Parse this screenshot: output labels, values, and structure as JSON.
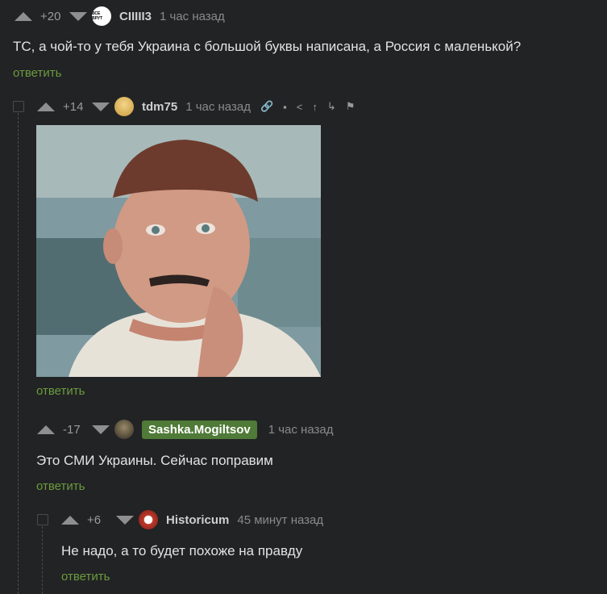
{
  "comments": [
    {
      "rating": "+20",
      "nick": "CIIIII3",
      "time": "1 час назад",
      "text": "ТС, а чой-то у тебя Украина с большой буквы написана, а Россия с маленькой?",
      "reply": "ответить",
      "avatar_text": "ВСЕ ВРУТ"
    },
    {
      "rating": "+14",
      "nick": "tdm75",
      "time": "1 час назад",
      "reply": "ответить"
    },
    {
      "rating": "-17",
      "nick": "Sashka.Mogiltsov",
      "time": "1 час назад",
      "text": "Это СМИ Украины. Сейчас поправим",
      "reply": "ответить"
    },
    {
      "rating": "+6",
      "nick": "Historicum",
      "time": "45 минут назад",
      "text": "Не надо, а то будет похоже на правду",
      "reply": "ответить"
    }
  ],
  "toolbar_icons": [
    "link-icon",
    "save-icon",
    "share-icon",
    "up-icon",
    "branch-icon",
    "flag-icon"
  ],
  "colors": {
    "background": "#222325",
    "reply": "#6b9b3d",
    "badge": "#4f7a37"
  }
}
